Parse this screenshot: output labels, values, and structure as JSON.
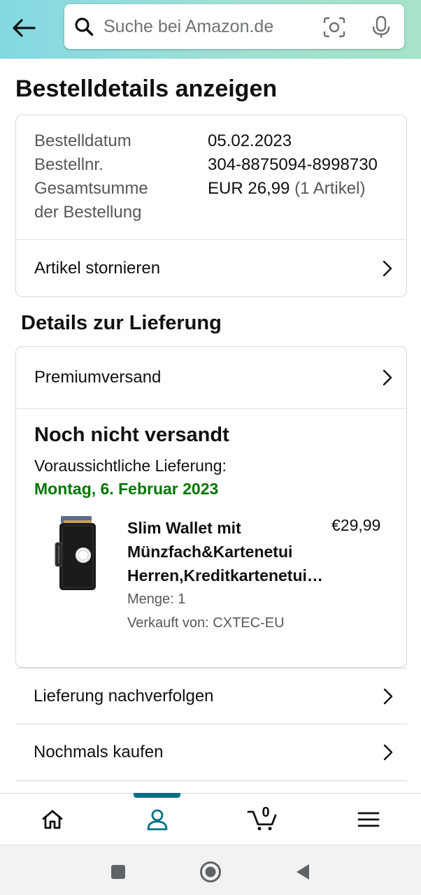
{
  "header": {
    "search_placeholder": "Suche bei Amazon.de",
    "back_icon": "arrow-left-icon",
    "search_icon": "search-icon",
    "camera_icon": "camera-scan-icon",
    "mic_icon": "microphone-icon"
  },
  "page_title": "Bestelldetails anzeigen",
  "summary": {
    "order_date_label": "Bestelldatum",
    "order_date": "05.02.2023",
    "order_number_label": "Bestellnr.",
    "order_number": "304-8875094-8998730",
    "total_label_line1": "Gesamtsumme",
    "total_label_line2": "der Bestellung",
    "total_value": "EUR 26,99",
    "total_items": "(1 Artikel)",
    "cancel_link": "Artikel stornieren"
  },
  "delivery": {
    "section_title": "Details zur Lieferung",
    "shipping_method": "Premiumversand",
    "status": "Noch nicht versandt",
    "expected_label": "Voraussichtliche Lieferung:",
    "expected_date": "Montag, 6. Februar 2023",
    "expected_date_color": "#007600",
    "product": {
      "title": "Slim Wallet mit Münzfach&Kartenetui Herren,Kreditkartenetui…",
      "price": "€29,99",
      "quantity": "Menge: 1",
      "seller": "Verkauft von: CXTEC-EU"
    }
  },
  "actions": {
    "track": "Lieferung nachverfolgen",
    "buy_again": "Nochmals kaufen"
  },
  "bottom_nav": {
    "items": [
      "home-icon",
      "account-icon",
      "cart-icon",
      "menu-icon"
    ],
    "active": "account-icon",
    "cart_count": "0",
    "accent_color": "#007185"
  },
  "system_nav": [
    "recents-icon",
    "home-circle-icon",
    "back-triangle-icon"
  ]
}
